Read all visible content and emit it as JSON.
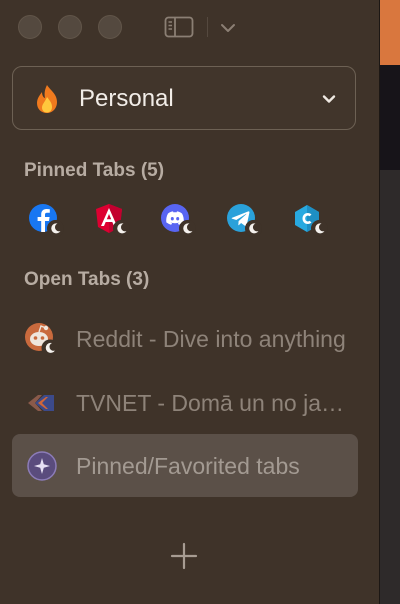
{
  "profile": {
    "name": "Personal",
    "icon": "flame-icon"
  },
  "pinned_section": {
    "title": "Pinned Tabs (5)"
  },
  "pinned": [
    {
      "icon": "facebook-icon",
      "color": "#1877f2"
    },
    {
      "icon": "angular-icon",
      "color": "#dd0031"
    },
    {
      "icon": "discord-icon",
      "color": "#5865f2"
    },
    {
      "icon": "telegram-icon",
      "color": "#2aa1da"
    },
    {
      "icon": "codesandbox-icon",
      "color": "#28a9e0"
    }
  ],
  "open_section": {
    "title": "Open Tabs (3)"
  },
  "tabs": [
    {
      "title": "Reddit - Dive into anything",
      "icon": "reddit-icon",
      "active": false
    },
    {
      "title": "TVNET - Domā un no jauna",
      "icon": "tvnet-icon",
      "active": false
    },
    {
      "title": "Pinned/Favorited tabs",
      "icon": "sparkle-icon",
      "active": true
    }
  ],
  "colors": {
    "background": "#3f3329",
    "accent": "#d9773e",
    "active_tab": "#5b5048"
  }
}
